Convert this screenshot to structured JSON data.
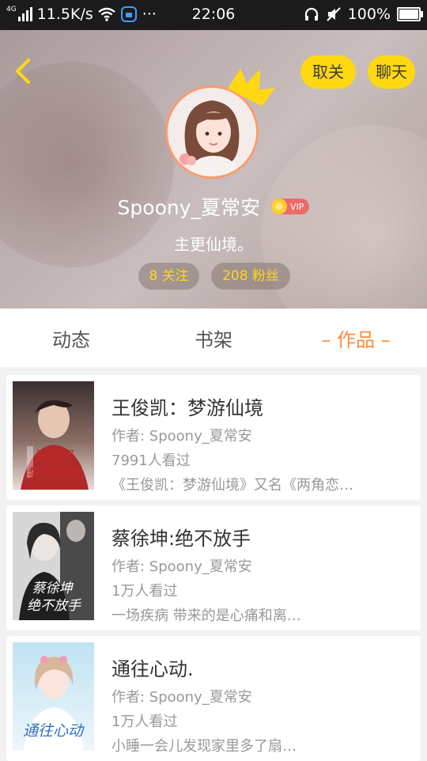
{
  "status_bar": {
    "network_tag": "4G",
    "speed": "11.5K/s",
    "time": "22:06",
    "battery": "100%"
  },
  "header": {
    "unfollow_label": "取关",
    "chat_label": "聊天",
    "username": "Spoony_夏常安",
    "vip_label": "VIP",
    "motto": "主更仙境。",
    "following": "8 关注",
    "fans": "208 粉丝"
  },
  "tabs": [
    "动态",
    "书架",
    "– 作品 –"
  ],
  "works": [
    {
      "title": "王俊凯：梦游仙境",
      "author": "作者: Spoony_夏常安",
      "views": "7991人看过",
      "summary": "《王俊凯：梦游仙境》又名《两角恋…",
      "cover_text": "王俊凯\n梦游仙境"
    },
    {
      "title": "蔡徐坤:绝不放手",
      "author": "作者: Spoony_夏常安",
      "views": "1万人看过",
      "summary": "一场疾病  带来的是心痛和离…",
      "cover_text": "蔡徐坤\n绝不放手"
    },
    {
      "title": "通往心动.",
      "author": "作者: Spoony_夏常安",
      "views": "1万人看过",
      "summary": "小睡一会儿发现家里多了扇…",
      "cover_text": "通往心动"
    }
  ],
  "colors": {
    "accent_yellow": "#ffd812",
    "tab_active": "#ff8a3c",
    "vip_red": "#ec6a6a"
  },
  "icons": [
    "back-arrow-icon",
    "crown-icon",
    "wifi-icon",
    "headset-icon",
    "mute-icon",
    "battery-icon"
  ]
}
